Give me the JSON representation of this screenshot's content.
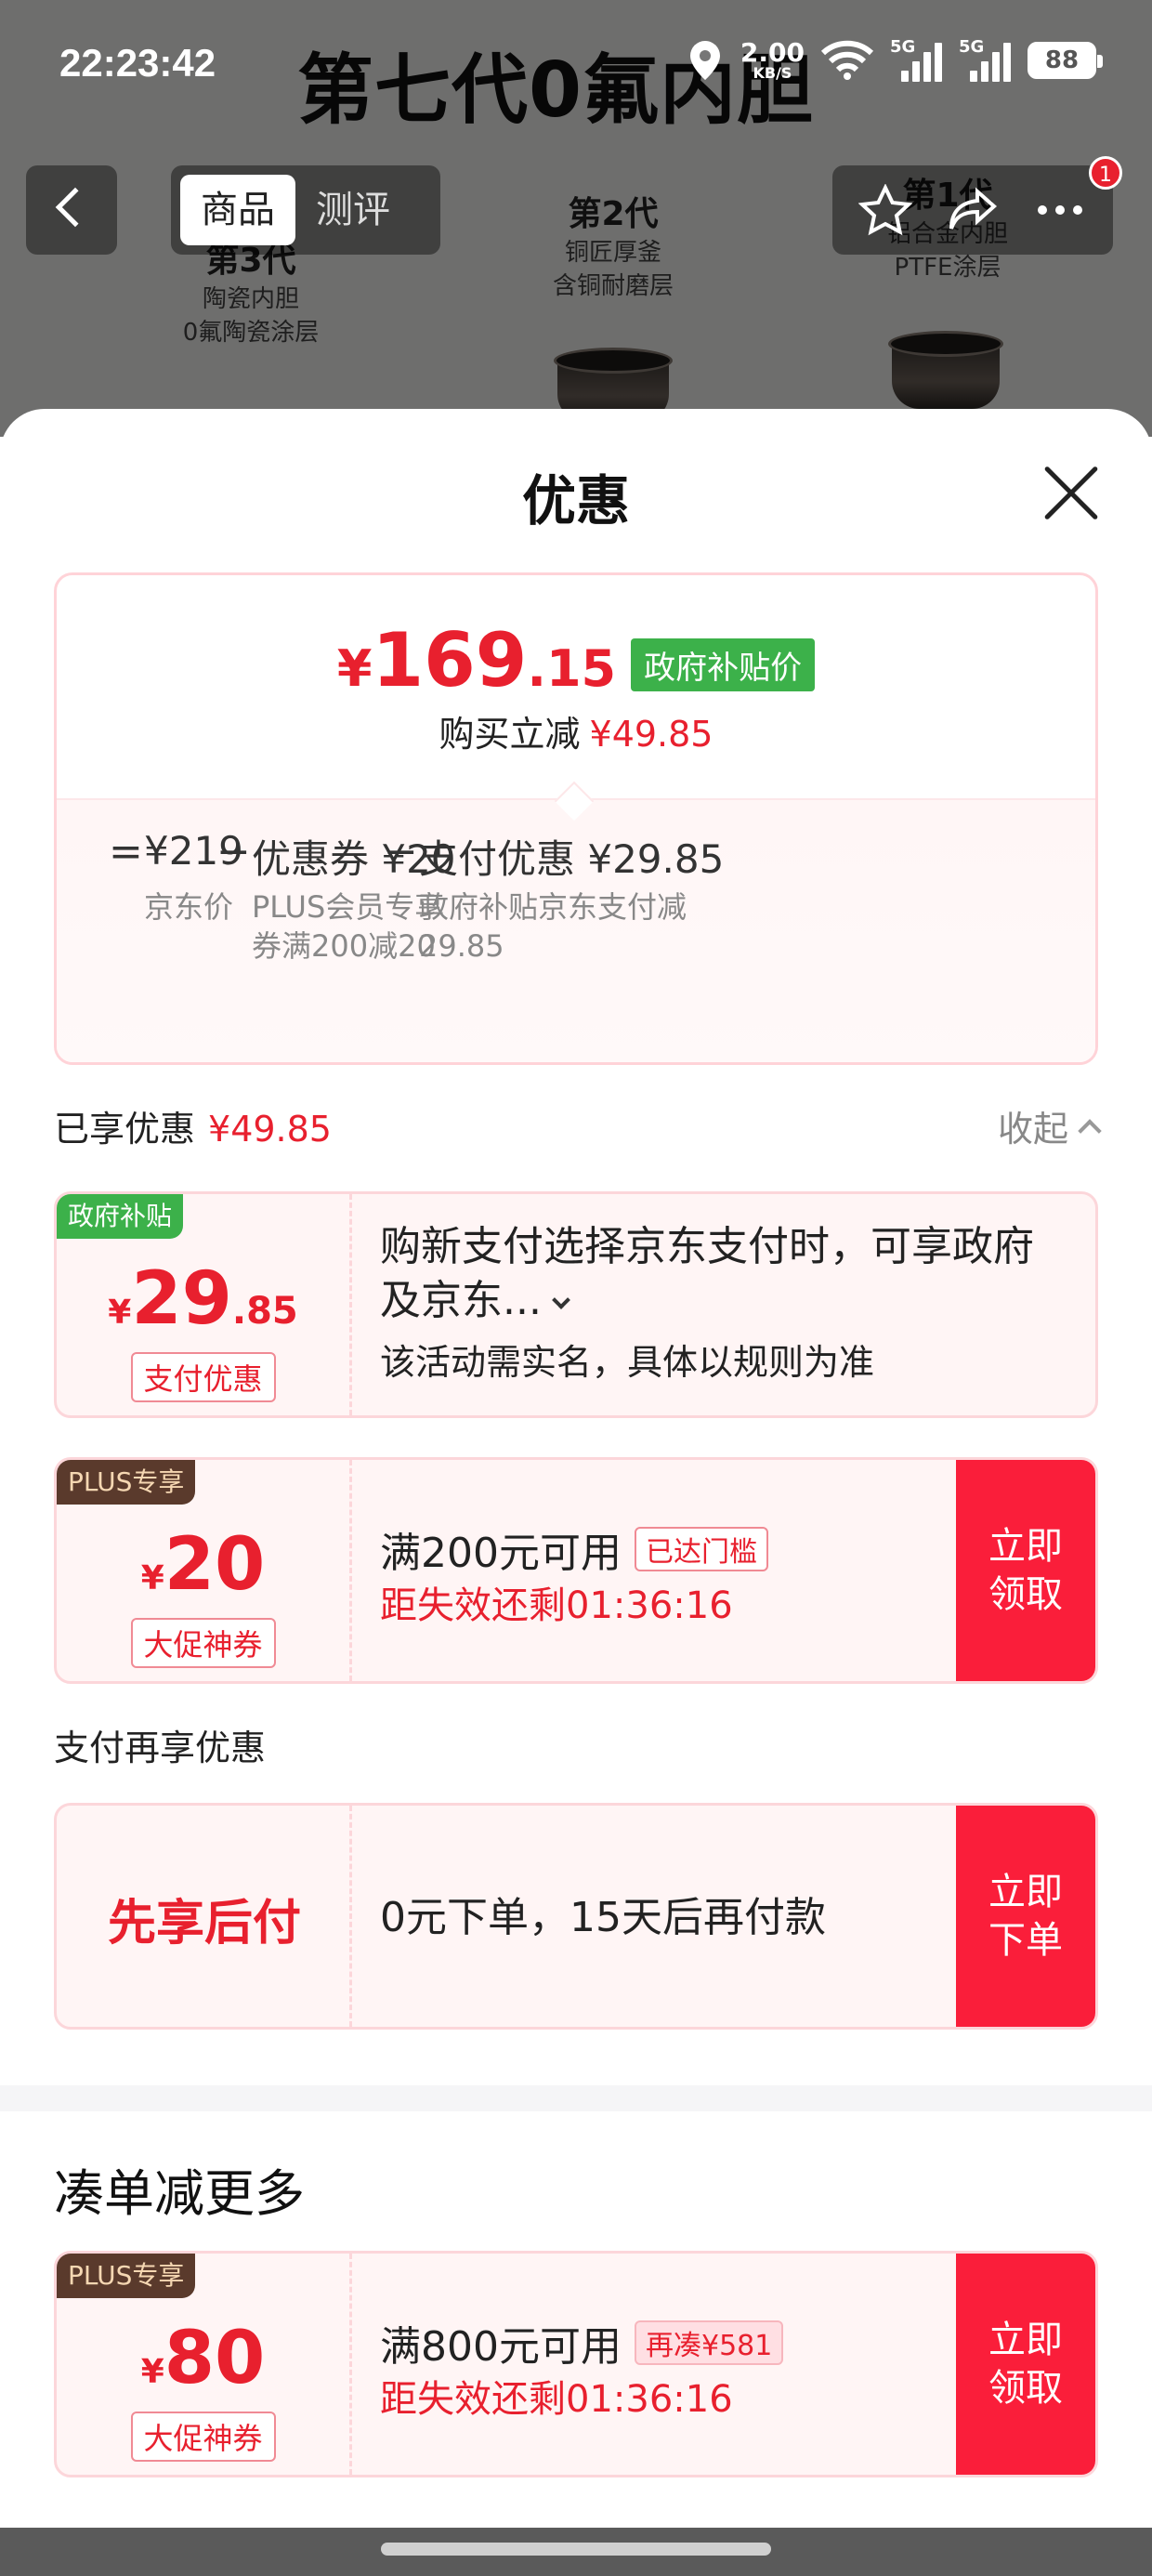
{
  "status_bar": {
    "time": "22:23:42",
    "net_speed": "2.00",
    "net_unit": "KB/S",
    "sim1": "5G",
    "sim2": "5G",
    "battery": "88"
  },
  "background_page": {
    "headline": "第七代0氟内胆",
    "tabs": [
      "商品",
      "测评"
    ],
    "badge": "1",
    "products": [
      {
        "gen": "第3代",
        "l1": "陶瓷内胆",
        "l2": "0氟陶瓷涂层"
      },
      {
        "gen": "第2代",
        "l1": "铜匠厚釜",
        "l2": "含铜耐磨层"
      },
      {
        "gen": "第1代",
        "l1": "铝合金内胆",
        "l2": "PTFE涂层"
      }
    ]
  },
  "sheet": {
    "title": "优惠",
    "summary": {
      "currency": "¥",
      "price_int": "169",
      "price_dec": ".15",
      "price_tag": "政府补贴价",
      "reduce_label": "购买立减",
      "reduce_amount": "¥49.85",
      "breakdown": {
        "eq": "=",
        "minus": "−",
        "jd_price": "¥219",
        "jd_label": "京东价",
        "coupon": "优惠券 ¥20",
        "coupon_desc": "PLUS会员专享券满200减20",
        "pay": "支付优惠 ¥29.85",
        "pay_desc": "政府补贴京东支付减29.85"
      }
    },
    "enjoyed": {
      "label": "已享优惠",
      "amount": "¥49.85",
      "collapse": "收起"
    },
    "offers": [
      {
        "tag": "政府补贴",
        "currency": "¥",
        "amount_int": "29",
        "amount_dec": ".85",
        "type": "支付优惠",
        "text": "购新支付选择京东支付时，可享政府及京东...",
        "note": "该活动需实名，具体以规则为准"
      },
      {
        "tag": "PLUS专享",
        "currency": "¥",
        "amount_int": "20",
        "type": "大促神券",
        "condition": "满200元可用",
        "status": "已达门槛",
        "timer": "距失效还剩01:36:16",
        "cta": "立即领取"
      }
    ],
    "pay_section": {
      "title": "支付再享优惠",
      "name": "先享后付",
      "desc": "0元下单，15天后再付款",
      "cta": "立即下单"
    },
    "more_section": {
      "title": "凑单减更多",
      "tag": "PLUS专享",
      "currency": "¥",
      "amount_int": "80",
      "type": "大促神券",
      "condition": "满800元可用",
      "status": "再凑¥581",
      "timer": "距失效还剩01:36:16",
      "cta": "立即领取"
    }
  },
  "colors": {
    "accent": "#e8202e",
    "cta": "#fa1e3a",
    "green": "#3cb14a",
    "plus": "#5a3a2c"
  }
}
